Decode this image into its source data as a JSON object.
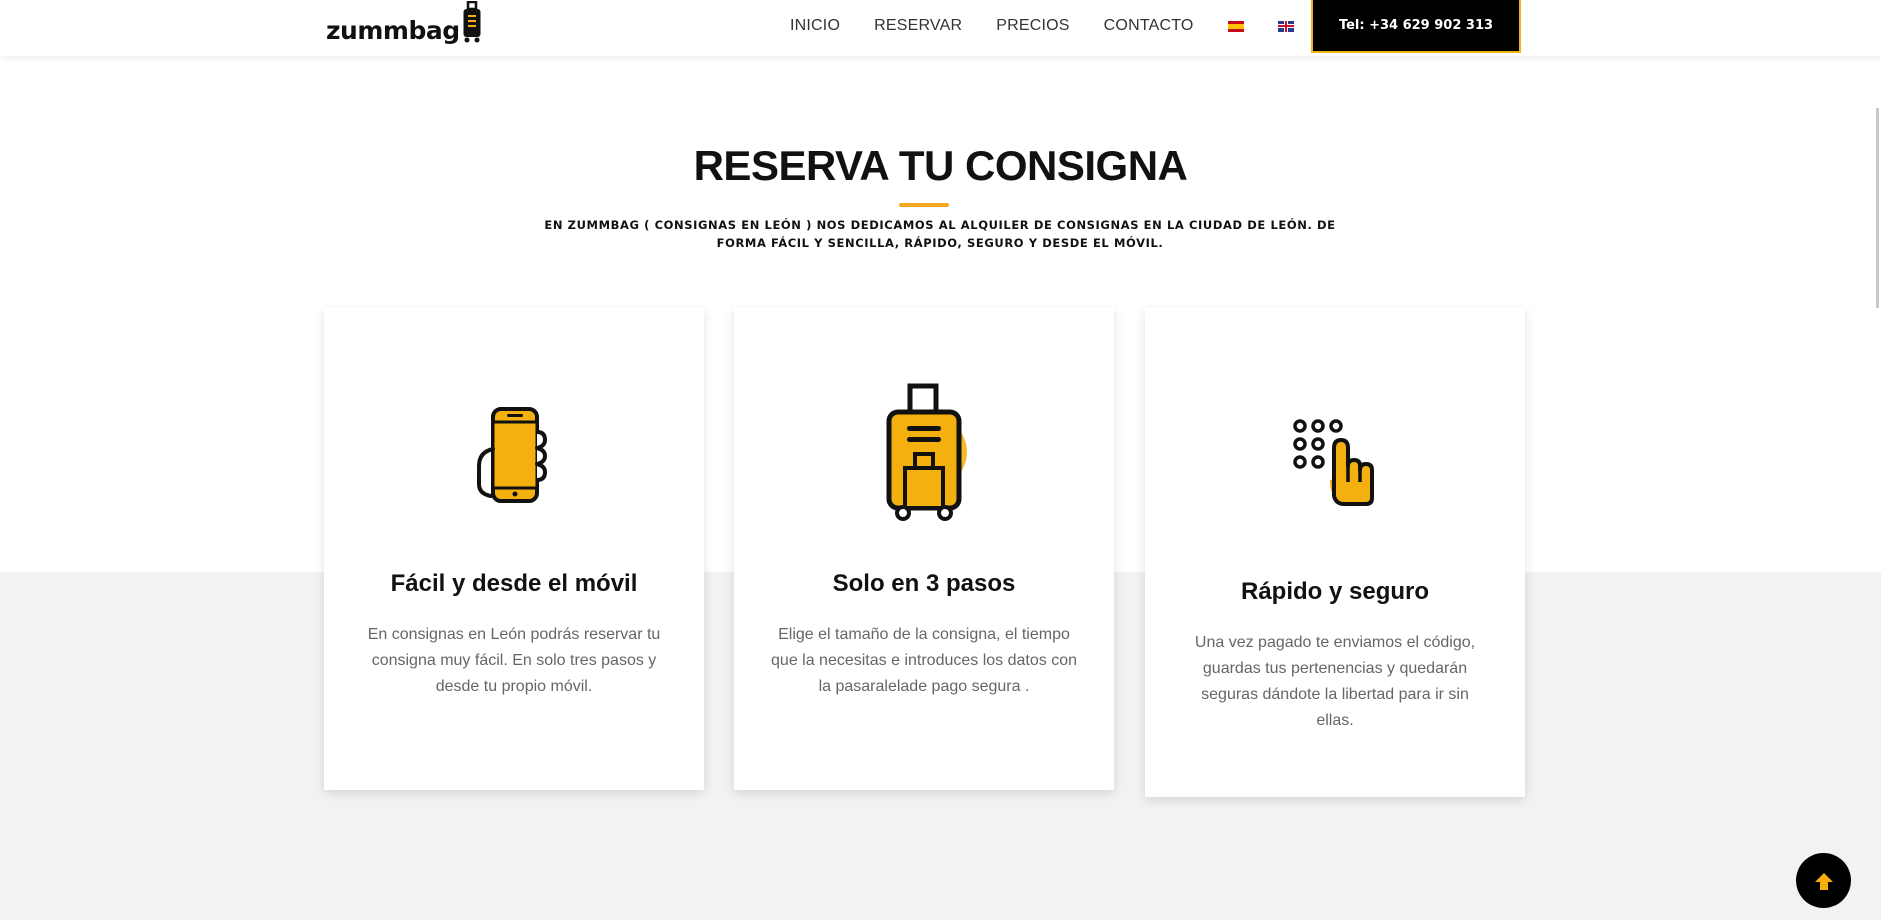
{
  "header": {
    "logo_text": "zummbag",
    "nav": [
      "INICIO",
      "RESERVAR",
      "PRECIOS",
      "CONTACTO"
    ],
    "tel_label": "Tel: +34 629 902 313"
  },
  "section": {
    "title": "RESERVA TU CONSIGNA",
    "subtitle": "EN ZUMMBAG ( CONSIGNAS EN LEÓN ) NOS DEDICAMOS AL ALQUILER DE CONSIGNAS EN LA CIUDAD DE LEÓN. DE FORMA FÁCIL Y SENCILLA, RÁPIDO, SEGURO Y DESDE EL MÓVIL."
  },
  "cards": [
    {
      "icon": "phone-in-hand-icon",
      "title": "Fácil y desde el móvil",
      "text": "En consignas en León podrás reservar tu consigna muy fácil. En solo tres pasos y desde tu propio móvil."
    },
    {
      "icon": "suitcase-icon",
      "title": "Solo en 3 pasos",
      "text": "Elige el tamaño de la consigna, el tiempo que la necesitas e introduces los datos con la pasaralelade pago segura ."
    },
    {
      "icon": "keypad-finger-icon",
      "title": "Rápido y seguro",
      "text": "Una vez pagado te enviamos el código, guardas tus pertenencias y quedarán seguras dándote la libertad para ir sin ellas."
    }
  ],
  "colors": {
    "accent": "#f4b00f",
    "dark": "#111111",
    "band": "#f3f2f0"
  }
}
